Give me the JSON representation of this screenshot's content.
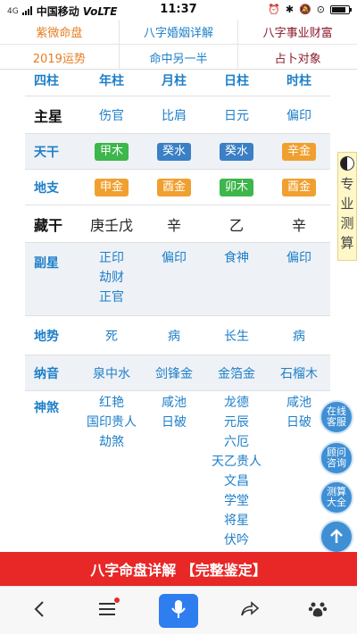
{
  "status_bar": {
    "signal_label": "4G",
    "carrier": "中国移动",
    "volte": "VoLTE",
    "time": "11:37",
    "battery_level": 0.85
  },
  "nav": {
    "row1": [
      "紫微命盘",
      "八字婚姻详解",
      "八字事业财富"
    ],
    "row2": [
      "2019运势",
      "命中另一半",
      "占卜对象"
    ],
    "colors": {
      "orange": "#e67e22",
      "blue": "#1e7fc8",
      "maroon": "#8b1a2a"
    }
  },
  "chart": {
    "header": [
      "四柱",
      "年柱",
      "月柱",
      "日柱",
      "时柱"
    ],
    "zhuxing": {
      "label": "主星",
      "values": [
        "伤官",
        "比肩",
        "日元",
        "偏印"
      ]
    },
    "tiangan": {
      "label": "天干",
      "values": [
        {
          "text": "甲木",
          "color": "#3db64b"
        },
        {
          "text": "癸水",
          "color": "#3b7fc4"
        },
        {
          "text": "癸水",
          "color": "#3b7fc4"
        },
        {
          "text": "辛金",
          "color": "#f0a030"
        }
      ]
    },
    "dizhi": {
      "label": "地支",
      "values": [
        {
          "text": "申金",
          "color": "#f0a030"
        },
        {
          "text": "酉金",
          "color": "#f0a030"
        },
        {
          "text": "卯木",
          "color": "#3db64b"
        },
        {
          "text": "酉金",
          "color": "#f0a030"
        }
      ]
    },
    "canggan": {
      "label": "藏干",
      "values": [
        "庚壬戊",
        "辛",
        "乙",
        "辛"
      ]
    },
    "fuxing": {
      "label": "副星",
      "values": [
        [
          "正印",
          "劫财",
          "正官"
        ],
        [
          "偏印"
        ],
        [
          "食神"
        ],
        [
          "偏印"
        ]
      ]
    },
    "dishi": {
      "label": "地势",
      "values": [
        "死",
        "病",
        "长生",
        "病"
      ]
    },
    "nayin": {
      "label": "纳音",
      "values": [
        "泉中水",
        "剑锋金",
        "金箔金",
        "石榴木"
      ]
    },
    "shensha": {
      "label": "神煞",
      "values": [
        [
          "红艳",
          "国印贵人",
          "劫煞"
        ],
        [
          "咸池",
          "日破"
        ],
        [
          "龙德",
          "元辰",
          "六厄",
          "天乙贵人",
          "文昌",
          "学堂",
          "将星",
          "伏吟"
        ],
        [
          "咸池",
          "日破"
        ]
      ]
    }
  },
  "side_tab": {
    "text": "专业测算"
  },
  "floating": {
    "online": "在线客服",
    "consult": "顾问咨询",
    "more": "测算大全"
  },
  "banner": {
    "text": "八字命盘详解 【完整鉴定】"
  }
}
